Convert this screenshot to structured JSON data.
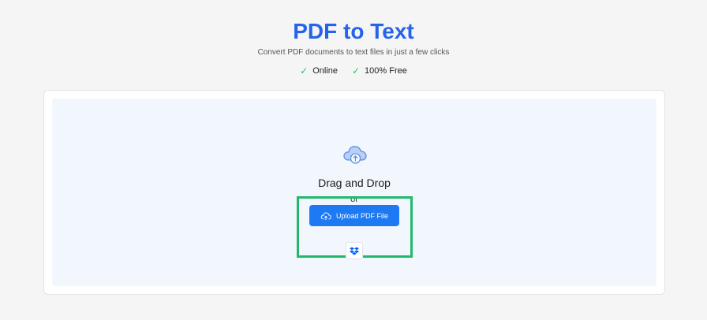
{
  "header": {
    "title": "PDF to Text",
    "subtitle": "Convert PDF documents to text files in just a few clicks",
    "features": [
      {
        "icon": "check-icon",
        "label": "Online"
      },
      {
        "icon": "check-icon",
        "label": "100% Free"
      }
    ]
  },
  "dropzone": {
    "icon": "cloud-upload-icon",
    "drag_label": "Drag and Drop",
    "or_label": "or",
    "upload_button_label": "Upload PDF File",
    "upload_button_icon": "cloud-upload-icon",
    "dropbox_icon": "dropbox-icon"
  },
  "colors": {
    "accent": "#2563eb",
    "button": "#1d7af3",
    "check": "#22c55e",
    "highlight": "#1fba6c",
    "dropzone_bg": "#f2f6fd"
  }
}
